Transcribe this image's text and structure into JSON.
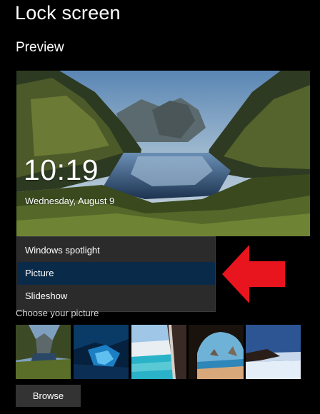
{
  "page": {
    "title": "Lock screen"
  },
  "preview": {
    "heading": "Preview",
    "time": "10:19",
    "date": "Wednesday, August 9"
  },
  "background_dropdown": {
    "options": [
      "Windows spotlight",
      "Picture",
      "Slideshow"
    ],
    "selected": "Picture"
  },
  "picture_chooser": {
    "label": "Choose your picture",
    "thumbnails": [
      "mountain-lake",
      "ice-cave",
      "beach-aerial",
      "sea-cave-arch",
      "desert-horizon"
    ]
  },
  "browse": {
    "label": "Browse"
  },
  "annotation": {
    "arrow_color": "#e8141e",
    "arrow_icon": "red-arrow-pointing-left"
  },
  "colors": {
    "background": "#000000",
    "dropdown_bg": "#2b2b2b",
    "selected_bg": "#0a2a4a",
    "button_bg": "#333333"
  }
}
